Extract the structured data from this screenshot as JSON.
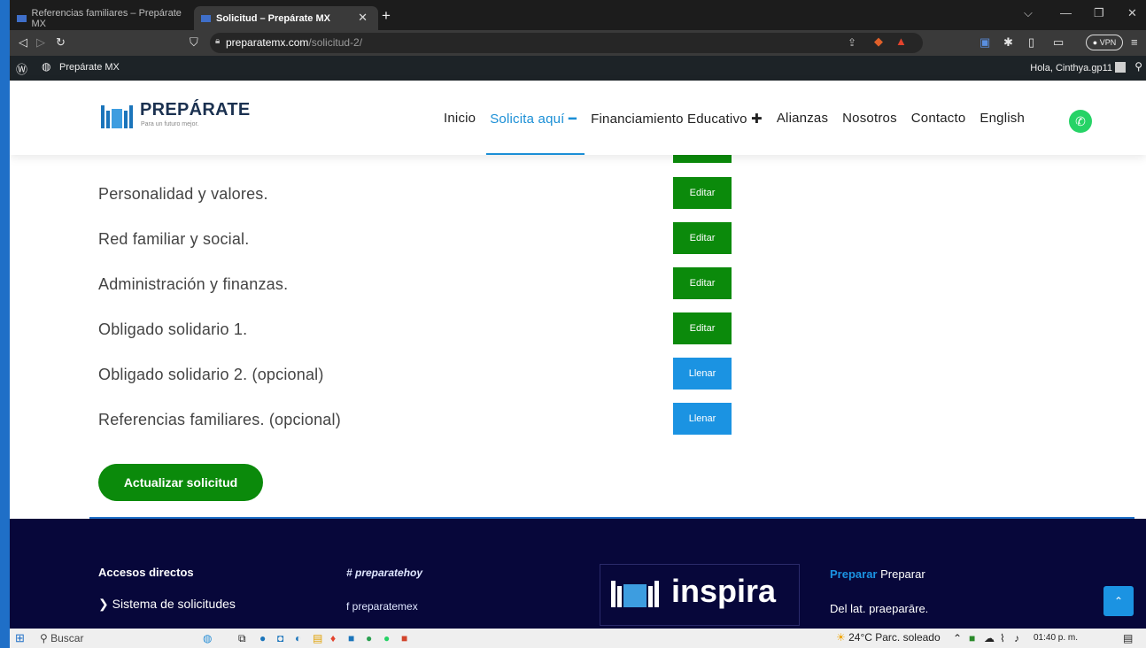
{
  "browser": {
    "tabs": [
      {
        "title": "Referencias familiares – Prepárate MX"
      },
      {
        "title": "Solicitud – Prepárate MX",
        "close": "✕"
      }
    ],
    "new_tab": "+",
    "url_host": "preparatemx.com",
    "url_path": "/solicitud-2/",
    "vpn": "● VPN"
  },
  "adminbar": {
    "site": "Prepárate MX",
    "greeting": "Hola, Cinthya.gp11"
  },
  "header": {
    "brand": "PREPÁRATE",
    "tagline": "Para un futuro mejor.",
    "nav": [
      "Inicio",
      "Solicita aquí ━",
      "Financiamiento Educativo ✚",
      "Alianzas",
      "Nosotros",
      "Contacto",
      "English"
    ]
  },
  "sections": [
    {
      "label": "Personalidad y valores.",
      "button": "Editar"
    },
    {
      "label": "Red familiar y social.",
      "button": "Editar"
    },
    {
      "label": "Administración y finanzas.",
      "button": "Editar"
    },
    {
      "label": "Obligado solidario 1.",
      "button": "Editar"
    },
    {
      "label": "Obligado solidario 2. (opcional)",
      "button": "Llenar"
    },
    {
      "label": "Referencias familiares. (opcional)",
      "button": "Llenar"
    }
  ],
  "update_button": "Actualizar solicitud",
  "footer": {
    "title": "Accesos directos",
    "item": "❯  Sistema de solicitudes",
    "hashtag": "# preparatehoy",
    "facebook": "f  preparatemex",
    "inspira": "inspira",
    "preparar_bold": "Preparar",
    "preparar_rest": " Preparar",
    "latin": "Del lat. praeparāre."
  },
  "taskbar": {
    "search": "Buscar",
    "weather": "24°C  Parc. soleado",
    "time": "01:40 p. m."
  },
  "colors": {
    "accent": "#1b8fd6",
    "edit_green": "#0b8a0b",
    "fill_blue": "#1b93e2",
    "footer_bg": "#07073a"
  }
}
